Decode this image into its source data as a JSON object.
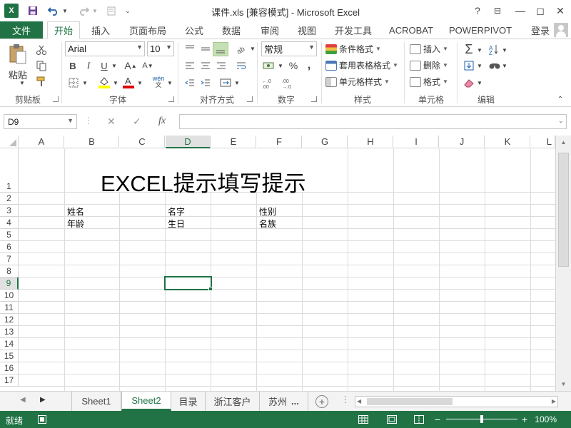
{
  "window": {
    "title": "课件.xls  [兼容模式] - Microsoft Excel",
    "help": "?",
    "minimize": "—",
    "restore": "◻",
    "close": "✕",
    "restore_ribbon": "⊟"
  },
  "ribbon_tabs": [
    "文件",
    "开始",
    "插入",
    "页面布局",
    "公式",
    "数据",
    "审阅",
    "视图",
    "开发工具",
    "ACROBAT",
    "POWERPIVOT"
  ],
  "active_tab": "开始",
  "login": "登录",
  "clipboard": {
    "paste": "粘贴",
    "group": "剪贴板"
  },
  "font": {
    "name": "Arial",
    "size": "10",
    "bold": "B",
    "italic": "I",
    "underline": "U",
    "grow": "A",
    "shrink": "A",
    "group": "字体",
    "wen": "wén"
  },
  "alignment": {
    "group": "对齐方式"
  },
  "number": {
    "format": "常规",
    "group": "数字",
    "percent": "%"
  },
  "styles": {
    "conditional": "条件格式",
    "table": "套用表格格式",
    "cell": "单元格样式",
    "group": "样式"
  },
  "cells": {
    "insert": "插入",
    "delete": "删除",
    "format": "格式",
    "group": "单元格"
  },
  "editing": {
    "sum": "Σ",
    "group": "编辑"
  },
  "formula_bar": {
    "name_box": "D9",
    "fx": "fx",
    "value": ""
  },
  "columns": [
    "A",
    "B",
    "C",
    "D",
    "E",
    "F",
    "G",
    "H",
    "I",
    "J",
    "K",
    "L"
  ],
  "selected_column": "D",
  "rows": [
    "1",
    "2",
    "3",
    "4",
    "5",
    "6",
    "7",
    "8",
    "9",
    "10",
    "11",
    "12",
    "13",
    "14",
    "15",
    "16",
    "17"
  ],
  "selected_row": "9",
  "cells_content": {
    "title": "EXCEL提示填写提示",
    "b3": "姓名",
    "d3": "名字",
    "f3": "性别",
    "b4": "年龄",
    "d4": "生日",
    "f4": "名族"
  },
  "sheets": [
    "Sheet1",
    "Sheet2",
    "目录",
    "浙江客户",
    "苏州"
  ],
  "active_sheet": "Sheet2",
  "sheet_more": "...",
  "status": {
    "ready": "就绪",
    "zoom": "100%",
    "zoom_level": 0.5
  },
  "accent_color": "#217346"
}
